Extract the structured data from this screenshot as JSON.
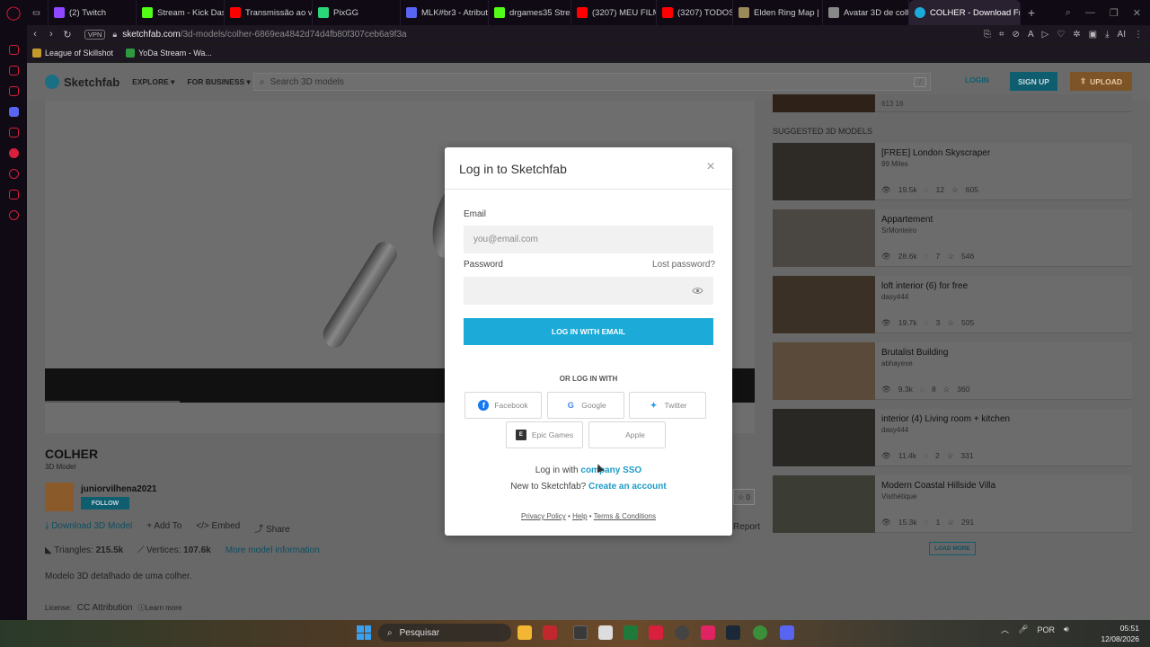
{
  "browser": {
    "tabs": [
      {
        "label": "(2) Twitch",
        "color": "#9146ff"
      },
      {
        "label": "Stream - Kick Dash",
        "color": "#53fc18"
      },
      {
        "label": "Transmissão ao viv",
        "color": "#ff0000"
      },
      {
        "label": "PixGG",
        "color": "#2bd67b"
      },
      {
        "label": "MLK#br3 - Atribute",
        "color": "#5865f2"
      },
      {
        "label": "drgames35 Stream",
        "color": "#53fc18"
      },
      {
        "label": "(3207) MEU FILME",
        "color": "#ff0000"
      },
      {
        "label": "(3207) TODOS OS",
        "color": "#ff0000"
      },
      {
        "label": "Elden Ring Map | M",
        "color": "#9a8a5a"
      },
      {
        "label": "Avatar 3D de colhe",
        "color": "#888888"
      },
      {
        "label": "COLHER - Download Free",
        "color": "#1caad9"
      }
    ],
    "active_tab_index": 10,
    "vpn_label": "VPN",
    "url_host": "sketchfab.com",
    "url_path": "/3d-models/colher-6869ea4842d74d4fb80f307ceb6a9f3a",
    "bookmarks": [
      "League of Skillshot",
      "YoDa Stream - Wa..."
    ]
  },
  "header": {
    "logo_text": "Sketchfab",
    "nav_explore": "EXPLORE",
    "nav_business": "FOR BUSINESS",
    "search_placeholder": "Search 3D models",
    "search_shortcut": "/",
    "login": "LOGIN",
    "signup": "SIGN UP",
    "upload": "UPLOAD"
  },
  "model": {
    "title": "COLHER",
    "kind": "3D Model",
    "author": "juniorvilhena2021",
    "follow": "FOLLOW",
    "actions": {
      "download": "Download 3D Model",
      "add_to": "Add To",
      "embed": "Embed",
      "share": "Share",
      "report": "Report",
      "likes": "0"
    },
    "stats": {
      "triangles_label": "Triangles:",
      "triangles": "215.5k",
      "vertices_label": "Vertices:",
      "vertices": "107.6k",
      "more_info": "More model information"
    },
    "description": "Modelo 3D detalhado de uma colher.",
    "license_label": "License:",
    "license": "CC Attribution",
    "learn_more": "Learn more"
  },
  "right_column": {
    "top_card_stats": "613   16",
    "suggested_heading": "SUGGESTED 3D MODELS",
    "suggestions": [
      {
        "title": "[FREE] London Skyscraper",
        "author": "99 Miles",
        "views": "19.5k",
        "comments": "12",
        "likes": "605",
        "thumb": "#2e2b26"
      },
      {
        "title": "Appartement",
        "author": "SrMonteiro",
        "views": "28.6k",
        "comments": "7",
        "likes": "546",
        "thumb": "#4a4642"
      },
      {
        "title": "loft interior (6) for free",
        "author": "dasy444",
        "views": "19.7k",
        "comments": "3",
        "likes": "505",
        "thumb": "#3a3026"
      },
      {
        "title": "Brutalist Building",
        "author": "abhayexe",
        "views": "9.3k",
        "comments": "8",
        "likes": "360",
        "thumb": "#5a4a3a"
      },
      {
        "title": "interior (4) Living room + kitchen",
        "author": "dasy444",
        "views": "11.4k",
        "comments": "2",
        "likes": "331",
        "thumb": "#2a2824"
      },
      {
        "title": "Modern Coastal Hillside Villa",
        "author": "Visthétique",
        "views": "15.3k",
        "comments": "1",
        "likes": "291",
        "thumb": "#3b3d34"
      }
    ],
    "load_more": "LOAD MORE"
  },
  "login_modal": {
    "title": "Log in to Sketchfab",
    "email_label": "Email",
    "email_placeholder": "you@email.com",
    "password_label": "Password",
    "lost_password": "Lost password?",
    "login_button": "LOG IN WITH EMAIL",
    "or_login_with": "OR LOG IN WITH",
    "social": {
      "facebook": "Facebook",
      "google": "Google",
      "twitter": "Twitter",
      "epic": "Epic Games",
      "apple": "Apple"
    },
    "sso_prefix": "Log in with ",
    "sso_link": "company SSO",
    "new_prefix": "New to Sketchfab? ",
    "create_account": "Create an account",
    "footer": {
      "privacy": "Privacy Policy",
      "sep1": " • ",
      "help": "Help",
      "sep2": " • ",
      "terms": "Terms & Conditions"
    }
  },
  "taskbar": {
    "search_placeholder": "Pesquisar",
    "lang": "POR",
    "time": "05:51",
    "date": "12/08/2026"
  },
  "colors": {
    "accent": "#1caad9",
    "sketchfab_teal": "#0e5e70",
    "upload_orange": "#e59a42",
    "opera_red": "#e0193a"
  }
}
